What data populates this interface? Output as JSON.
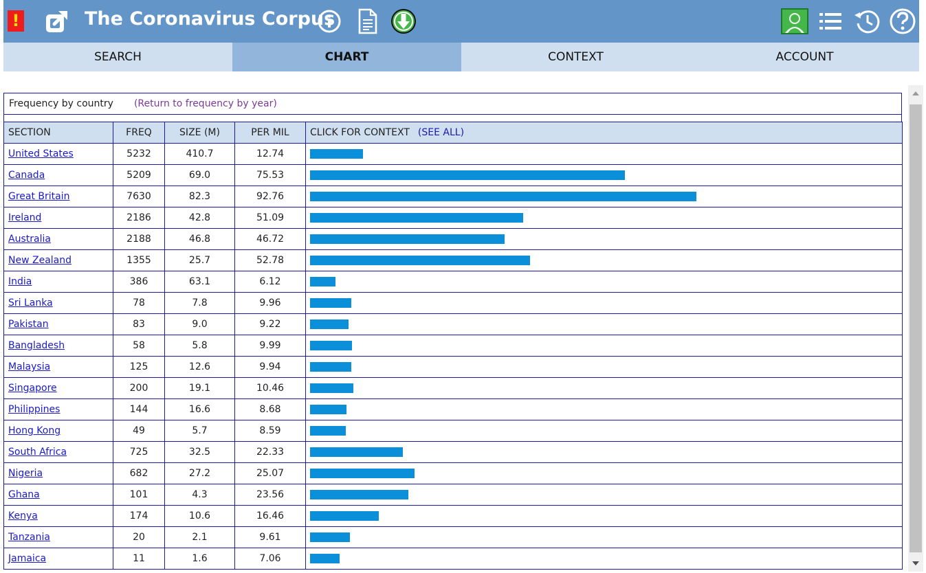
{
  "header": {
    "alert": "!",
    "title": "The Coronavirus Corpus",
    "icons": [
      "external-link-icon",
      "info-icon",
      "document-icon",
      "download-icon",
      "user-icon",
      "list-icon",
      "history-icon",
      "help-icon"
    ],
    "colors": {
      "bar": "#6395c9",
      "alert_bg": "#ef1c1c",
      "download_bg": "#45b74a"
    }
  },
  "tabs": [
    {
      "label": "SEARCH",
      "active": false
    },
    {
      "label": "CHART",
      "active": true
    },
    {
      "label": "CONTEXT",
      "active": false
    },
    {
      "label": "ACCOUNT",
      "active": false
    }
  ],
  "caption": {
    "label": "Frequency by country",
    "return_link": "(Return to frequency by year)"
  },
  "table": {
    "headers": {
      "section": "SECTION",
      "freq": "FREQ",
      "size": "SIZE (M)",
      "per_mil": "PER MIL",
      "context": "CLICK FOR CONTEXT",
      "see_all": "(SEE ALL)"
    },
    "rows": [
      {
        "section": "United States",
        "freq": "5232",
        "size": "410.7",
        "per_mil": "12.74"
      },
      {
        "section": "Canada",
        "freq": "5209",
        "size": "69.0",
        "per_mil": "75.53"
      },
      {
        "section": "Great Britain",
        "freq": "7630",
        "size": "82.3",
        "per_mil": "92.76"
      },
      {
        "section": "Ireland",
        "freq": "2186",
        "size": "42.8",
        "per_mil": "51.09"
      },
      {
        "section": "Australia",
        "freq": "2188",
        "size": "46.8",
        "per_mil": "46.72"
      },
      {
        "section": "New Zealand",
        "freq": "1355",
        "size": "25.7",
        "per_mil": "52.78"
      },
      {
        "section": "India",
        "freq": "386",
        "size": "63.1",
        "per_mil": "6.12"
      },
      {
        "section": "Sri Lanka",
        "freq": "78",
        "size": "7.8",
        "per_mil": "9.96"
      },
      {
        "section": "Pakistan",
        "freq": "83",
        "size": "9.0",
        "per_mil": "9.22"
      },
      {
        "section": "Bangladesh",
        "freq": "58",
        "size": "5.8",
        "per_mil": "9.99"
      },
      {
        "section": "Malaysia",
        "freq": "125",
        "size": "12.6",
        "per_mil": "9.94"
      },
      {
        "section": "Singapore",
        "freq": "200",
        "size": "19.1",
        "per_mil": "10.46"
      },
      {
        "section": "Philippines",
        "freq": "144",
        "size": "16.6",
        "per_mil": "8.68"
      },
      {
        "section": "Hong Kong",
        "freq": "49",
        "size": "5.7",
        "per_mil": "8.59"
      },
      {
        "section": "South Africa",
        "freq": "725",
        "size": "32.5",
        "per_mil": "22.33"
      },
      {
        "section": "Nigeria",
        "freq": "682",
        "size": "27.2",
        "per_mil": "25.07"
      },
      {
        "section": "Ghana",
        "freq": "101",
        "size": "4.3",
        "per_mil": "23.56"
      },
      {
        "section": "Kenya",
        "freq": "174",
        "size": "10.6",
        "per_mil": "16.46"
      },
      {
        "section": "Tanzania",
        "freq": "20",
        "size": "2.1",
        "per_mil": "9.61"
      },
      {
        "section": "Jamaica",
        "freq": "11",
        "size": "1.6",
        "per_mil": "7.06"
      }
    ]
  }
}
